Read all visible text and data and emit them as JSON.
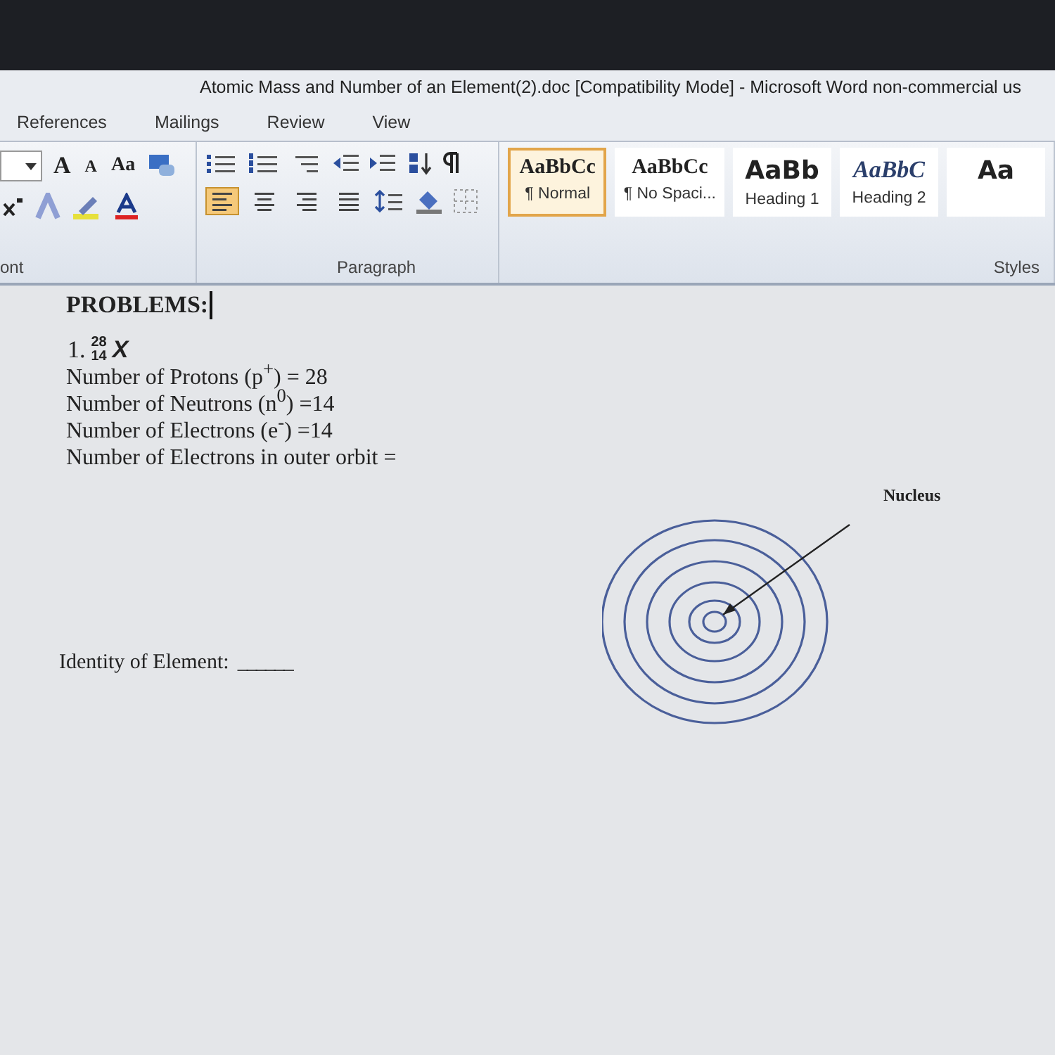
{
  "window": {
    "title": "Atomic Mass and Number of an Element(2).doc [Compatibility Mode] - Microsoft Word non-commercial us"
  },
  "tabs": [
    {
      "label": "References",
      "selected": false
    },
    {
      "label": "Mailings",
      "selected": false
    },
    {
      "label": "Review",
      "selected": false
    },
    {
      "label": "View",
      "selected": false
    }
  ],
  "ribbon": {
    "font_buttons": [
      "A",
      "A",
      "Aa"
    ],
    "align_buttons": [
      {
        "selected": true
      },
      {
        "selected": false
      },
      {
        "selected": false
      },
      {
        "selected": false
      }
    ],
    "groups": [
      "ont",
      "Paragraph",
      "Styles"
    ],
    "styles": [
      {
        "sample": "AaBbCc",
        "label": "¶ Normal",
        "kind": "plain",
        "selected": true
      },
      {
        "sample": "AaBbCc",
        "label": "¶ No Spaci...",
        "kind": "plain",
        "selected": false
      },
      {
        "sample": "AaBb",
        "label": "Heading 1",
        "kind": "heading1",
        "selected": false
      },
      {
        "sample": "AaBbC",
        "label": "Heading 2",
        "kind": "heading2",
        "selected": false
      },
      {
        "sample": "Aa",
        "kind": "heading1",
        "selected": false
      }
    ]
  },
  "document": {
    "heading": "PROBLEMS:",
    "problem_number": "1.",
    "mass_number": "28",
    "atomic_number": "14",
    "symbol": "X",
    "lines": [
      "Number of Protons (p$^{+}$) = 28",
      "Number of Neutrons (n$^{0}$) =14",
      "Number of Electrons (e$^{-}$) =14",
      "Number of Electrons in outer orbit ="
    ],
    "identity_label": "Identity of Element:",
    "identity_blank": "______",
    "diagram": {
      "label": "Nucleus"
    }
  }
}
